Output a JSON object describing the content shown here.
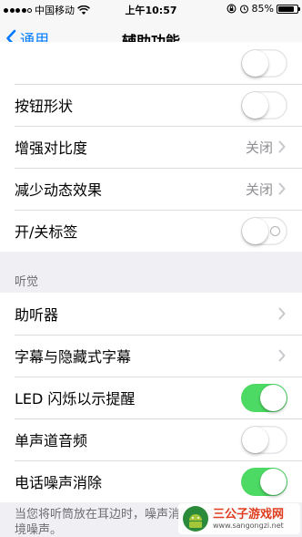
{
  "status_bar": {
    "carrier": "中国移动",
    "time": "上午10:57",
    "battery_percent": "85%",
    "battery_level": 0.85,
    "signal_bars": 4,
    "icons": [
      "wifi-icon",
      "rotation-lock-icon",
      "alarm-icon",
      "battery-icon"
    ]
  },
  "nav": {
    "back_label": "通用",
    "title": "辅助功能"
  },
  "groups": {
    "top": {
      "partial_label": "",
      "rows": [
        {
          "label": "按钮形状",
          "control": "switch",
          "on": false
        },
        {
          "label": "增强对比度",
          "control": "value",
          "value": "关闭"
        },
        {
          "label": "减少动态效果",
          "control": "value",
          "value": "关闭"
        },
        {
          "label": "开/关标签",
          "control": "switch",
          "on": false
        }
      ]
    },
    "hearing": {
      "header": "听觉",
      "rows": [
        {
          "label": "助听器",
          "control": "chevron"
        },
        {
          "label": "字幕与隐藏式字幕",
          "control": "chevron"
        },
        {
          "label": "LED 闪烁以示提醒",
          "control": "switch",
          "on": true
        },
        {
          "label": "单声道音频",
          "control": "switch",
          "on": false
        },
        {
          "label": "电话噪声消除",
          "control": "switch",
          "on": true
        }
      ]
    }
  },
  "footer": {
    "text": "当您将听筒放在耳边时，噪声消除可减少电话中的环境噪声。"
  },
  "watermark": {
    "title": "三公子游戏网",
    "url": "www.sangongzi.net"
  },
  "colors": {
    "accent": "#007aff",
    "switch_on": "#4cd964",
    "background": "#efeff4"
  }
}
